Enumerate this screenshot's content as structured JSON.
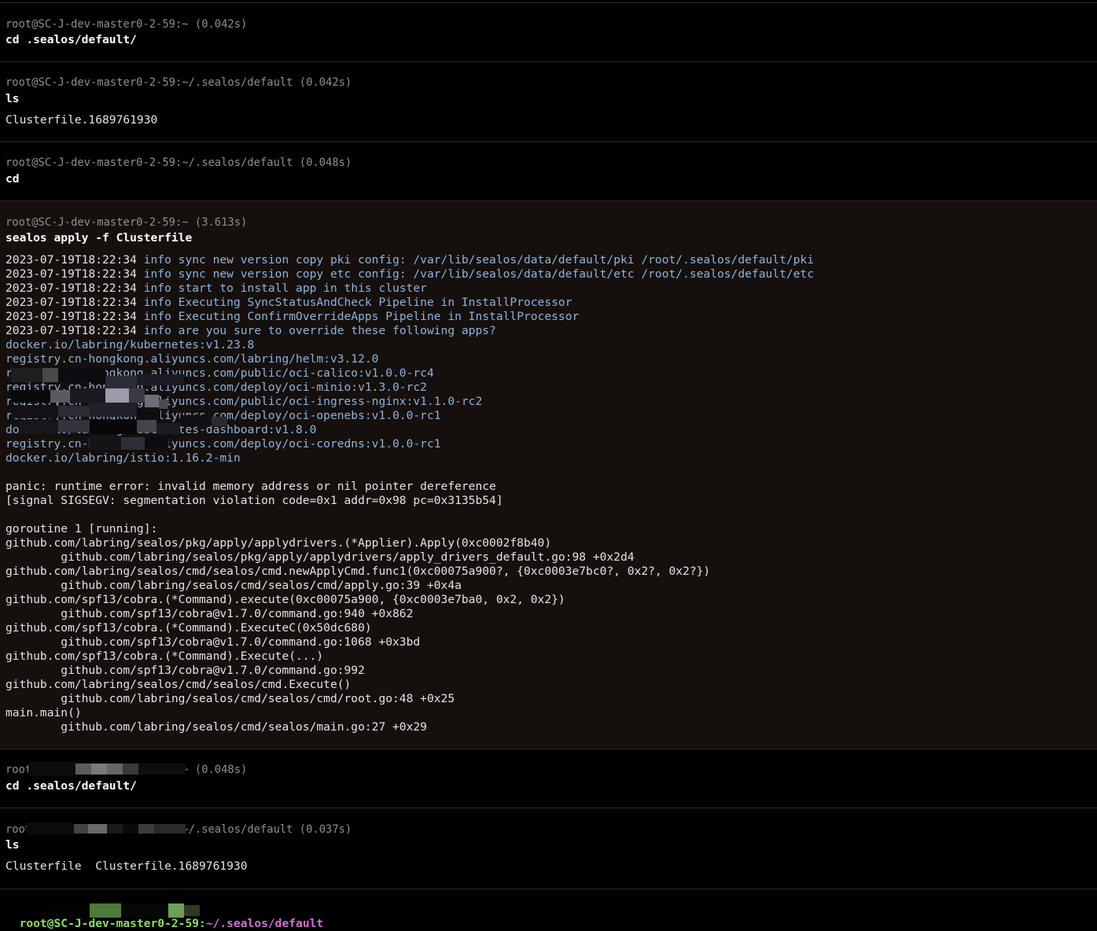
{
  "blocks": [
    {
      "prompt": "root@SC-J-dev-master0-2-59:~ (0.042s)",
      "command": "cd .sealos/default/",
      "output": []
    },
    {
      "prompt": "root@SC-J-dev-master0-2-59:~/.sealos/default (0.042s)",
      "command": "ls",
      "output": [
        "Clusterfile.1689761930"
      ]
    },
    {
      "prompt": "root@SC-J-dev-master0-2-59:~/.sealos/default (0.048s)",
      "command": "cd",
      "output": []
    },
    {
      "prompt": "root@SC-J-dev-master0-2-59:~ (3.613s)",
      "command": "sealos apply -f Clusterfile",
      "logs": [
        {
          "ts": "2023-07-19T18:22:34",
          "msg": "info sync new version copy pki config: /var/lib/sealos/data/default/pki /root/.sealos/default/pki"
        },
        {
          "ts": "2023-07-19T18:22:34",
          "msg": "info sync new version copy etc config: /var/lib/sealos/data/default/etc /root/.sealos/default/etc"
        },
        {
          "ts": "2023-07-19T18:22:34",
          "msg": "info start to install app in this cluster"
        },
        {
          "ts": "2023-07-19T18:22:34",
          "msg": "info Executing SyncStatusAndCheck Pipeline in InstallProcessor"
        },
        {
          "ts": "2023-07-19T18:22:34",
          "msg": "info Executing ConfirmOverrideApps Pipeline in InstallProcessor"
        },
        {
          "ts": "2023-07-19T18:22:34",
          "msg": "info are you sure to override these following apps?"
        }
      ],
      "apps": [
        "docker.io/labring/kubernetes:v1.23.8",
        "registry.cn-hongkong.aliyuncs.com/labring/helm:v3.12.0",
        "registry.cn-hongkong.aliyuncs.com/public/oci-calico:v1.0.0-rc4",
        "registry.cn-hongkong.aliyuncs.com/deploy/oci-minio:v1.3.0-rc2",
        "registry.cn-hongkong.aliyuncs.com/public/oci-ingress-nginx:v1.1.0-rc2",
        "registry.cn-hongkong.aliyuncs.com/deploy/oci-openebs:v1.0.0-rc1",
        "docker.io/labring/kubernetes-dashboard:v1.8.0",
        "registry.cn-hongkong.aliyuncs.com/deploy/oci-coredns:v1.0.0-rc1",
        "docker.io/labring/istio:1.16.2-min"
      ],
      "panic": [
        "panic: runtime error: invalid memory address or nil pointer dereference",
        "[signal SIGSEGV: segmentation violation code=0x1 addr=0x98 pc=0x3135b54]"
      ],
      "trace": [
        "goroutine 1 [running]:",
        "github.com/labring/sealos/pkg/apply/applydrivers.(*Applier).Apply(0xc0002f8b40)",
        "        github.com/labring/sealos/pkg/apply/applydrivers/apply_drivers_default.go:98 +0x2d4",
        "github.com/labring/sealos/cmd/sealos/cmd.newApplyCmd.func1(0xc00075a900?, {0xc0003e7bc0?, 0x2?, 0x2?})",
        "        github.com/labring/sealos/cmd/sealos/cmd/apply.go:39 +0x4a",
        "github.com/spf13/cobra.(*Command).execute(0xc00075a900, {0xc0003e7ba0, 0x2, 0x2})",
        "        github.com/spf13/cobra@v1.7.0/command.go:940 +0x862",
        "github.com/spf13/cobra.(*Command).ExecuteC(0x50dc680)",
        "        github.com/spf13/cobra@v1.7.0/command.go:1068 +0x3bd",
        "github.com/spf13/cobra.(*Command).Execute(...)",
        "        github.com/spf13/cobra@v1.7.0/command.go:992",
        "github.com/labring/sealos/cmd/sealos/cmd.Execute()",
        "        github.com/labring/sealos/cmd/sealos/cmd/root.go:48 +0x25",
        "main.main()",
        "        github.com/labring/sealos/cmd/sealos/main.go:27 +0x29"
      ]
    },
    {
      "prompt": "root@SC-J-dev-master0-2-59:~ (0.048s)",
      "command": "cd .sealos/default/",
      "output": []
    },
    {
      "prompt": "root@SC-J-dev-master0-2-59:~/.sealos/default (0.037s)",
      "command": "ls",
      "output": [
        "Clusterfile  Clusterfile.1689761930"
      ]
    }
  ],
  "live_prompt": {
    "user_host": "root@SC-J-dev-master0-2-59:",
    "path": "~/.sealos/default"
  },
  "colors": {
    "background": "#000000",
    "error_block_bg": "#150f0e",
    "prompt_gray": "#8e8e8e",
    "info_blue": "#8fb3d8",
    "live_user_green": "#8fdb5f",
    "live_path_magenta": "#d36fd8"
  }
}
